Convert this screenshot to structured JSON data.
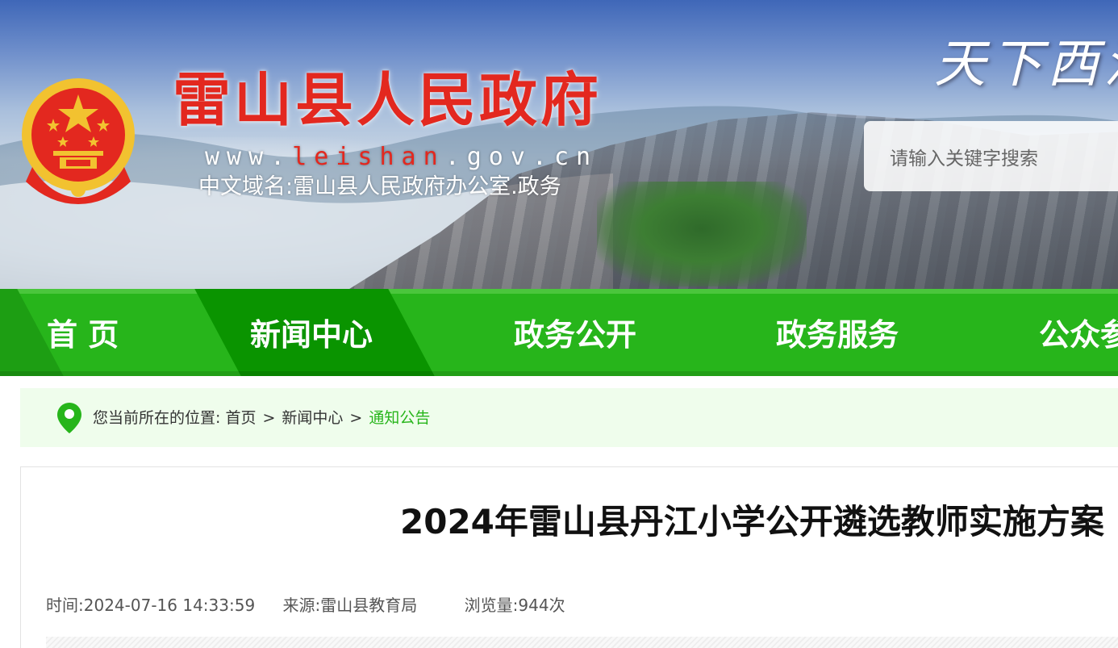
{
  "header": {
    "site_title": "雷山县人民政府",
    "domain_prefix": "www.",
    "domain_highlight": "leishan",
    "domain_suffix": ".gov.cn",
    "cn_domain": "中文域名:雷山县人民政府办公室.政务",
    "slogan": "天下西江",
    "search_placeholder": "请输入关键字搜索"
  },
  "nav": {
    "items": [
      {
        "label": "首 页"
      },
      {
        "label": "新闻中心"
      },
      {
        "label": "政务公开"
      },
      {
        "label": "政务服务"
      },
      {
        "label": "公众参与"
      }
    ],
    "active_index": 1
  },
  "breadcrumb": {
    "prefix": "您当前所在的位置:",
    "items": [
      "首页",
      "新闻中心",
      "通知公告"
    ],
    "separator": ">"
  },
  "article": {
    "title": "2024年雷山县丹江小学公开遴选教师实施方案",
    "time_label": "时间:",
    "time": "2024-07-16 14:33:59",
    "source_label": "来源:",
    "source": "雷山县教育局",
    "views_label": "浏览量:",
    "views": "944次"
  },
  "colors": {
    "nav_green": "#27b51b",
    "nav_active": "#0a9400",
    "title_red": "#e3281f",
    "breadcrumb_bg": "#effdec"
  },
  "icons": {
    "emblem": "national-emblem-icon",
    "location": "location-pin-icon"
  }
}
